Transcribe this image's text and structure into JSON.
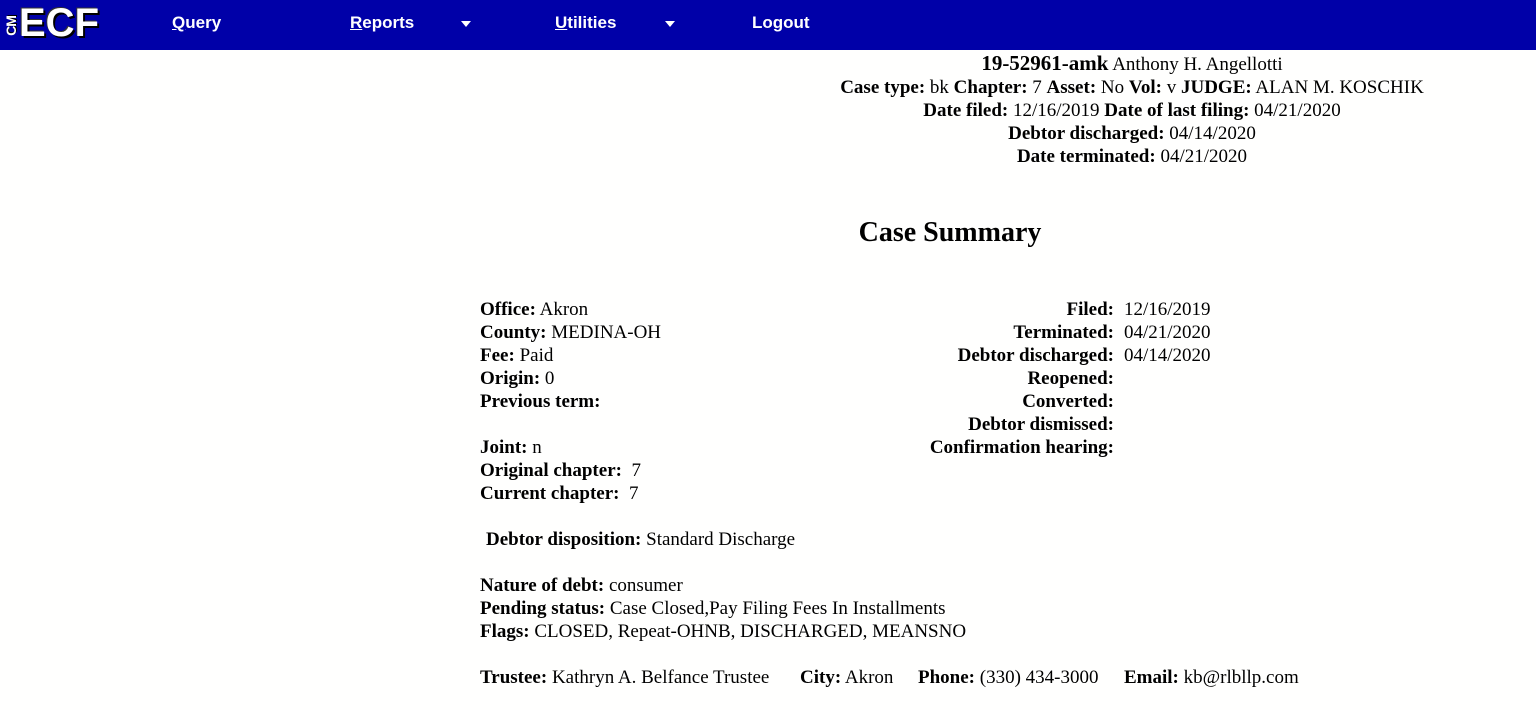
{
  "logo": {
    "cm": "CM",
    "ecf": "ECF"
  },
  "nav": {
    "query_first": "Q",
    "query_rest": "uery",
    "reports_first": "R",
    "reports_rest": "eports",
    "utilities_first": "U",
    "utilities_rest": "tilities",
    "logout": "Logout"
  },
  "case_header": {
    "case_number": "19-52961-amk",
    "debtor_name": "Anthony H. Angellotti",
    "case_type_label": "Case type:",
    "case_type": "bk",
    "chapter_label": "Chapter:",
    "chapter": "7",
    "asset_label": "Asset:",
    "asset": "No",
    "vol_label": "Vol:",
    "vol": "v",
    "judge_label": "JUDGE:",
    "judge": "ALAN M. KOSCHIK",
    "date_filed_label": "Date filed:",
    "date_filed": "12/16/2019",
    "last_filing_label": "Date of last filing:",
    "last_filing": "04/21/2020",
    "discharged_label": "Debtor discharged:",
    "discharged": "04/14/2020",
    "terminated_label": "Date terminated:",
    "terminated": "04/21/2020"
  },
  "summary": {
    "title": "Case Summary",
    "office_label": "Office:",
    "office": "Akron",
    "county_label": "County:",
    "county": "MEDINA-OH",
    "fee_label": "Fee:",
    "fee": "Paid",
    "origin_label": "Origin:",
    "origin": "0",
    "previous_term_label": "Previous term:",
    "joint_label": "Joint:",
    "joint": "n",
    "original_chapter_label": "Original chapter:",
    "original_chapter": "7",
    "current_chapter_label": "Current chapter:",
    "current_chapter": "7",
    "filed_label": "Filed:",
    "filed": "12/16/2019",
    "terminated_label": "Terminated:",
    "terminated": "04/21/2020",
    "debtor_discharged_label": "Debtor discharged:",
    "debtor_discharged": "04/14/2020",
    "reopened_label": "Reopened:",
    "converted_label": "Converted:",
    "debtor_dismissed_label": "Debtor dismissed:",
    "confirmation_hearing_label": "Confirmation hearing:",
    "disposition_label": "Debtor disposition:",
    "disposition": "Standard Discharge",
    "nature_label": "Nature of debt:",
    "nature": "consumer",
    "pending_label": "Pending status:",
    "pending": "Case Closed,Pay Filing Fees In Installments",
    "flags_label": "Flags:",
    "flags": "CLOSED, Repeat-OHNB, DISCHARGED, MEANSNO",
    "trustee_label": "Trustee:",
    "trustee": "Kathryn A. Belfance Trustee",
    "city_label": "City:",
    "city": "Akron",
    "phone_label": "Phone:",
    "phone": "(330) 434-3000",
    "email_label": "Email:",
    "email": "kb@rlbllp.com"
  }
}
